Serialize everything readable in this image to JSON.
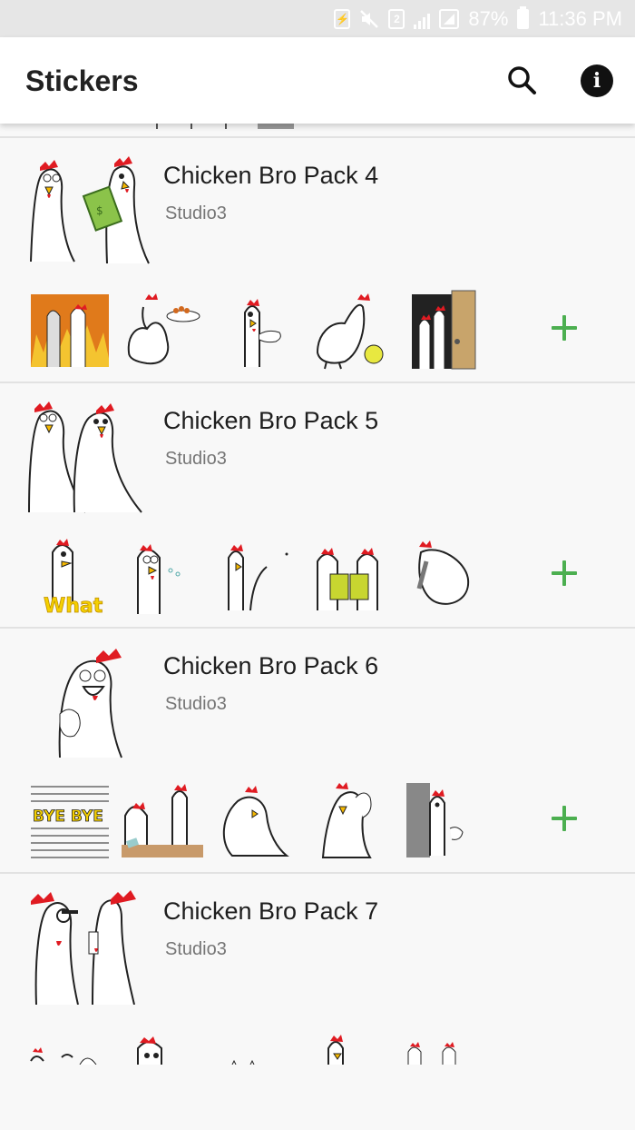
{
  "status_bar": {
    "battery": "87%",
    "time": "11:36 PM",
    "sim_slot": "2"
  },
  "app_bar": {
    "title": "Stickers",
    "search_icon": "search-icon",
    "info_icon": "info-icon"
  },
  "packs": [
    {
      "name": "Chicken Bro Pack 4",
      "author": "Studio3"
    },
    {
      "name": "Chicken Bro Pack 5",
      "author": "Studio3"
    },
    {
      "name": "Chicken Bro Pack 6",
      "author": "Studio3"
    },
    {
      "name": "Chicken Bro Pack 7",
      "author": "Studio3"
    }
  ],
  "sticker_text": {
    "what": "What",
    "bye_bye": "BYE BYE"
  },
  "colors": {
    "add_button": "#4caf50",
    "comb_red": "#e01b22",
    "app_bar_bg": "#ffffff",
    "status_bar_bg": "#e6e6e6",
    "list_bg": "#f8f8f8"
  }
}
